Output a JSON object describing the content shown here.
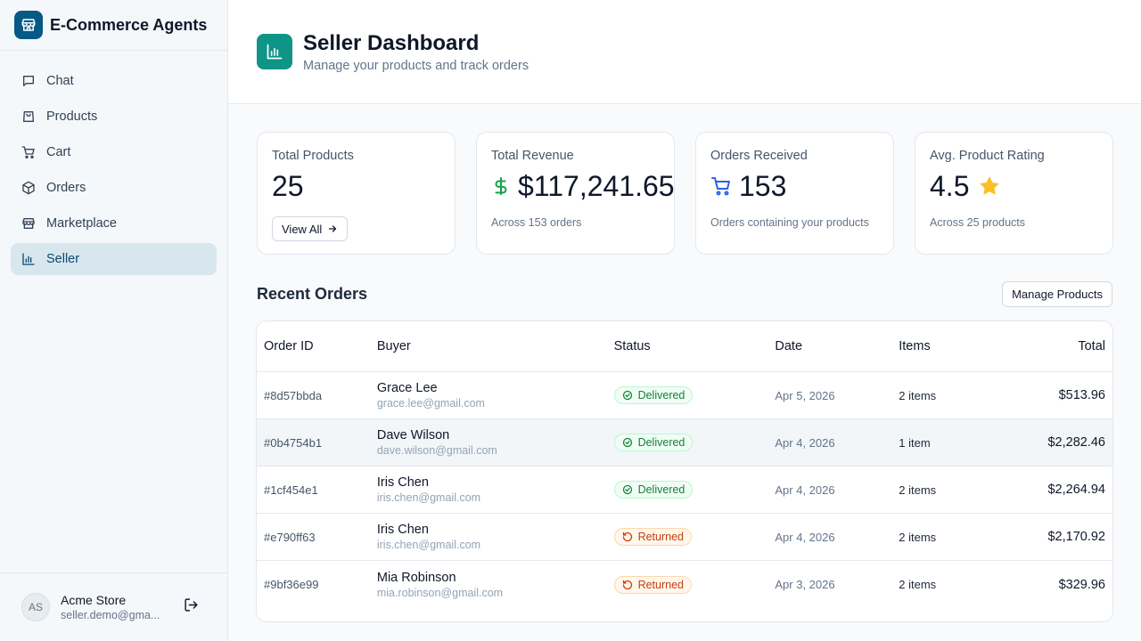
{
  "app": {
    "title": "E-Commerce Agents"
  },
  "sidebar": {
    "items": [
      {
        "label": "Chat",
        "icon": "chat-icon"
      },
      {
        "label": "Products",
        "icon": "shopping-bag-icon"
      },
      {
        "label": "Cart",
        "icon": "cart-icon"
      },
      {
        "label": "Orders",
        "icon": "package-icon"
      },
      {
        "label": "Marketplace",
        "icon": "store-icon"
      },
      {
        "label": "Seller",
        "icon": "bar-chart-icon",
        "active": true
      }
    ],
    "user": {
      "initials": "AS",
      "name": "Acme Store",
      "email": "seller.demo@gma..."
    }
  },
  "header": {
    "title": "Seller Dashboard",
    "subtitle": "Manage your products and track orders"
  },
  "stats": {
    "total_products": {
      "label": "Total Products",
      "value": "25",
      "button": "View All"
    },
    "total_revenue": {
      "label": "Total Revenue",
      "value": "$117,241.65",
      "note": "Across 153 orders"
    },
    "orders_received": {
      "label": "Orders Received",
      "value": "153",
      "note": "Orders containing your products"
    },
    "avg_rating": {
      "label": "Avg. Product Rating",
      "value": "4.5",
      "note": "Across 25 products"
    }
  },
  "orders": {
    "title": "Recent Orders",
    "manage_button": "Manage Products",
    "columns": [
      "Order ID",
      "Buyer",
      "Status",
      "Date",
      "Items",
      "Total"
    ],
    "rows": [
      {
        "id": "#8d57bbda",
        "buyer": "Grace Lee",
        "email": "grace.lee@gmail.com",
        "status": "Delivered",
        "date": "Apr 5, 2026",
        "items": "2 items",
        "total": "$513.96"
      },
      {
        "id": "#0b4754b1",
        "buyer": "Dave Wilson",
        "email": "dave.wilson@gmail.com",
        "status": "Delivered",
        "date": "Apr 4, 2026",
        "items": "1 item",
        "total": "$2,282.46"
      },
      {
        "id": "#1cf454e1",
        "buyer": "Iris Chen",
        "email": "iris.chen@gmail.com",
        "status": "Delivered",
        "date": "Apr 4, 2026",
        "items": "2 items",
        "total": "$2,264.94"
      },
      {
        "id": "#e790ff63",
        "buyer": "Iris Chen",
        "email": "iris.chen@gmail.com",
        "status": "Returned",
        "date": "Apr 4, 2026",
        "items": "2 items",
        "total": "$2,170.92"
      },
      {
        "id": "#9bf36e99",
        "buyer": "Mia Robinson",
        "email": "mia.robinson@gmail.com",
        "status": "Returned",
        "date": "Apr 3, 2026",
        "items": "2 items",
        "total": "$329.96"
      }
    ]
  },
  "colors": {
    "brand": "#075985",
    "accent": "#0f9488",
    "active_bg": "#d8e6ee",
    "delivered": "#15803d",
    "returned": "#c2410c",
    "star": "#fbbf24",
    "revenue": "#16a34a",
    "cart": "#2563eb"
  }
}
